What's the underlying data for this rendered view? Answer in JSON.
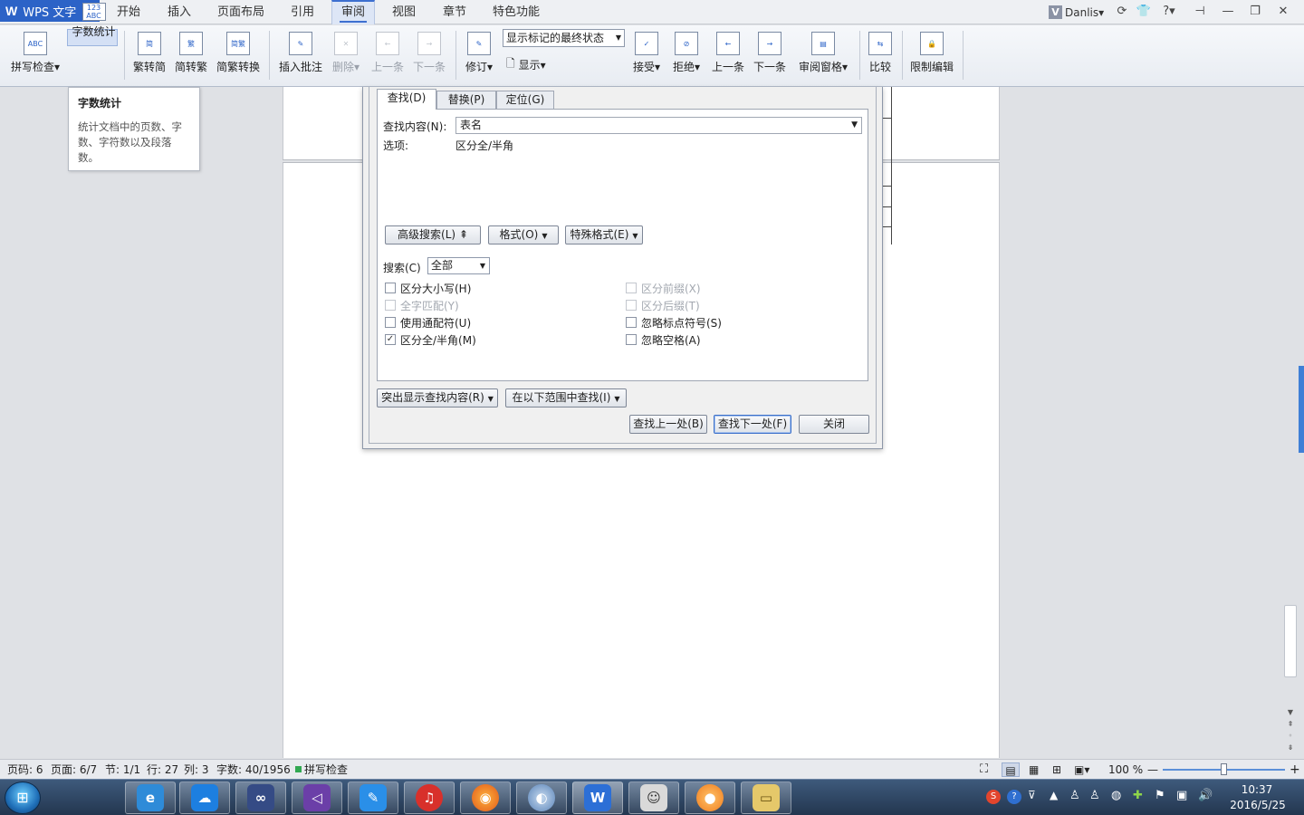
{
  "app": {
    "name": "WPS 文字",
    "caret": "▾"
  },
  "menu": [
    {
      "label": "开始"
    },
    {
      "label": "插入"
    },
    {
      "label": "页面布局"
    },
    {
      "label": "引用"
    },
    {
      "label": "审阅"
    },
    {
      "label": "视图"
    },
    {
      "label": "章节"
    },
    {
      "label": "特色功能"
    }
  ],
  "user": {
    "badge": "V",
    "name": "Danlis▾"
  },
  "title_icons": {
    "sync": "⟳",
    "skin": "👕",
    "help": "?▾",
    "pin": "⊣",
    "min": "—",
    "max": "❐",
    "close": "✕"
  },
  "ribbon": {
    "spell": "拼写检查▾",
    "count": "字数统计",
    "t2s": "繁转简",
    "s2t": "简转繁",
    "convert": "简繁转换",
    "insert_comment": "插入批注",
    "delete": "删除▾",
    "prev": "上一条",
    "next": "下一条",
    "revise": "修订▾",
    "track_state": "显示标记的最终状态",
    "show": "显示▾",
    "accept": "接受▾",
    "reject": "拒绝▾",
    "prev2": "上一条",
    "next2": "下一条",
    "pane": "审阅窗格▾",
    "compare": "比较",
    "restrict": "限制编辑",
    "icon_abc": "ABC",
    "icon_123": "123 ABC",
    "icon_jian": "简",
    "icon_fan": "繁",
    "icon_jf": "简繁"
  },
  "tooltip": {
    "title": "字数统计",
    "desc": "统计文档中的页数、字数、字符数以及段落数。"
  },
  "dialog": {
    "tabs": [
      "查找(D)",
      "替换(P)",
      "定位(G)"
    ],
    "find_label": "查找内容(N):",
    "find_value": "表名",
    "options_label": "选项:",
    "options_value": "区分全/半角",
    "advanced_btn": "高级搜索(L) ⇞",
    "format_btn": "格式(O)",
    "special_btn": "特殊格式(E)",
    "search_label": "搜索(C)",
    "search_value": "全部",
    "checks_left": [
      {
        "label": "区分大小写(H)",
        "checked": false,
        "disabled": false
      },
      {
        "label": "全字匹配(Y)",
        "checked": false,
        "disabled": true
      },
      {
        "label": "使用通配符(U)",
        "checked": false,
        "disabled": false
      },
      {
        "label": "区分全/半角(M)",
        "checked": true,
        "disabled": false
      }
    ],
    "checks_right": [
      {
        "label": "区分前缀(X)",
        "checked": false,
        "disabled": true
      },
      {
        "label": "区分后缀(T)",
        "checked": false,
        "disabled": true
      },
      {
        "label": "忽略标点符号(S)",
        "checked": false,
        "disabled": false
      },
      {
        "label": "忽略空格(A)",
        "checked": false,
        "disabled": false
      }
    ],
    "highlight_btn": "突出显示查找内容(R)",
    "scope_btn": "在以下范围中查找(I)",
    "prev_btn": "查找上一处(B)",
    "next_btn": "查找下一处(F)",
    "close_btn": "关闭",
    "check_mark": "✓"
  },
  "status": {
    "page": "页码: 6",
    "pages": "页面: 6/7",
    "section": "节: 1/1",
    "row": "行: 27",
    "col": "列: 3",
    "words": "字数: 40/1956",
    "spell": "拼写检查",
    "zoom": "100 %",
    "minus": "—",
    "plus": "+"
  },
  "tray": {
    "time": "10:37",
    "date": "2016/5/25"
  }
}
